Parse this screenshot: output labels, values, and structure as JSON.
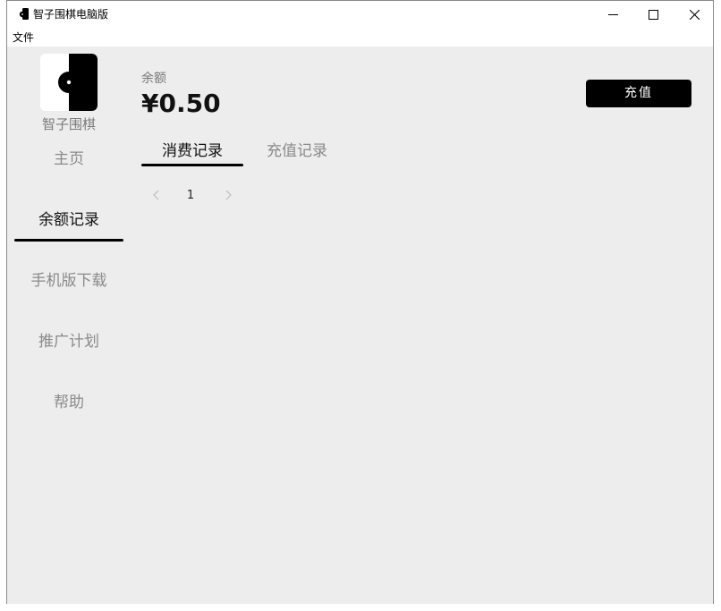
{
  "window": {
    "title": "智子围棋电脑版",
    "controls": {
      "minimize_icon": "minimize-icon",
      "maximize_icon": "maximize-icon",
      "close_icon": "close-icon"
    }
  },
  "menubar": {
    "items": [
      {
        "label": "文件"
      }
    ]
  },
  "sidebar": {
    "app_name": "智子围棋",
    "logo_icon": "go-stone-logo-icon",
    "items": [
      {
        "label": "主页",
        "active": false
      },
      {
        "label": "余额记录",
        "active": true
      },
      {
        "label": "手机版下载",
        "active": false
      },
      {
        "label": "推广计划",
        "active": false
      },
      {
        "label": "帮助",
        "active": false
      }
    ]
  },
  "balance": {
    "label": "余额",
    "value": "¥0.50"
  },
  "actions": {
    "recharge_label": "充值"
  },
  "tabs": [
    {
      "label": "消费记录",
      "active": true
    },
    {
      "label": "充值记录",
      "active": false
    }
  ],
  "pagination": {
    "current_page": "1",
    "prev_icon": "chevron-left-icon",
    "next_icon": "chevron-right-icon"
  },
  "colors": {
    "background": "#ededed",
    "accent": "#000000",
    "inactive_text": "#8a8a8a"
  }
}
